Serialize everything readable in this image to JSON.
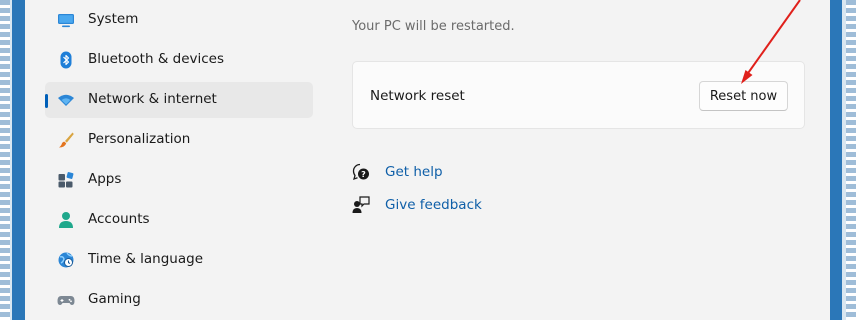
{
  "sidebar": {
    "items": [
      {
        "label": "System",
        "icon": "monitor-icon"
      },
      {
        "label": "Bluetooth & devices",
        "icon": "bluetooth-icon"
      },
      {
        "label": "Network & internet",
        "icon": "wifi-icon",
        "selected": true
      },
      {
        "label": "Personalization",
        "icon": "brush-icon"
      },
      {
        "label": "Apps",
        "icon": "apps-icon"
      },
      {
        "label": "Accounts",
        "icon": "person-icon"
      },
      {
        "label": "Time & language",
        "icon": "globe-clock-icon"
      },
      {
        "label": "Gaming",
        "icon": "controller-icon"
      }
    ]
  },
  "main": {
    "info_text": "Your PC will be restarted.",
    "network_reset": {
      "label": "Network reset",
      "button_label": "Reset now"
    },
    "links": [
      {
        "label": "Get help",
        "icon": "help-icon"
      },
      {
        "label": "Give feedback",
        "icon": "feedback-icon"
      }
    ]
  },
  "colors": {
    "accent": "#005fb8",
    "link": "#0f5fa8",
    "annotation_arrow": "#e0201b",
    "frame": "#2b77b8"
  }
}
